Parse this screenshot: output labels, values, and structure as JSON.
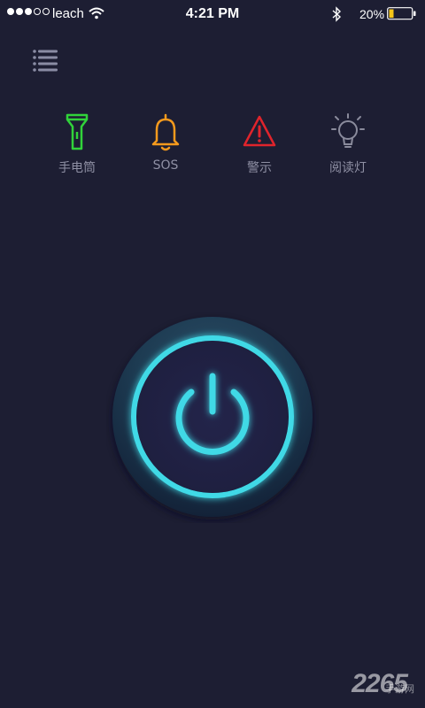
{
  "status_bar": {
    "carrier": "leach",
    "time": "4:21 PM",
    "battery": "20%",
    "signal_dots": [
      "full",
      "full",
      "full",
      "empty",
      "empty"
    ]
  },
  "menu": {
    "icon": "list-menu-icon"
  },
  "modes": [
    {
      "label": "手电筒",
      "icon": "flashlight-icon",
      "color": "#31d33a"
    },
    {
      "label": "SOS",
      "icon": "bell-icon",
      "color": "#f59a1d"
    },
    {
      "label": "警示",
      "icon": "warning-triangle-icon",
      "color": "#e0242c"
    },
    {
      "label": "阅读灯",
      "icon": "lightbulb-icon",
      "color": "#8a8b9c"
    }
  ],
  "power_button": {
    "icon": "power-icon",
    "accent": "#3fd9e6"
  },
  "watermark": {
    "text": "2265",
    "sub": "手游网"
  }
}
